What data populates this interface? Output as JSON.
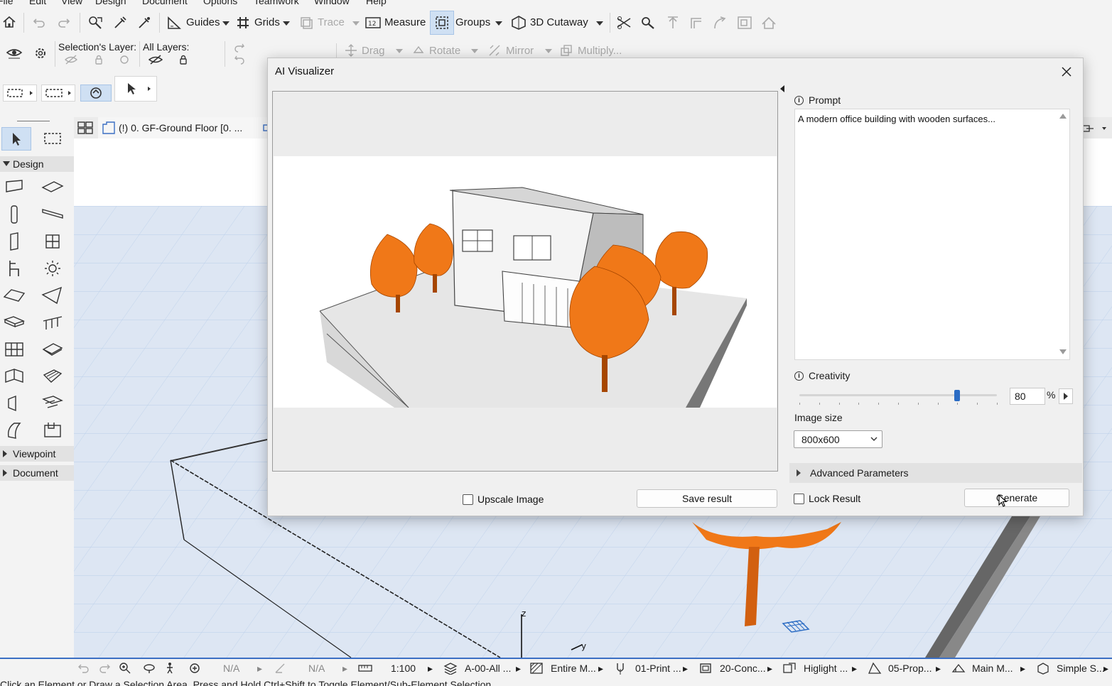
{
  "menu": [
    "File",
    "Edit",
    "View",
    "Design",
    "Document",
    "Options",
    "Teamwork",
    "Window",
    "Help"
  ],
  "toolbar1": {
    "guides": "Guides",
    "grids": "Grids",
    "trace": "Trace",
    "measure": "Measure",
    "groups": "Groups",
    "cutaway": "3D Cutaway"
  },
  "toolbar2": {
    "selection_layer": "Selection's Layer:",
    "all_layers": "All Layers:",
    "drag": "Drag",
    "rotate": "Rotate",
    "mirror": "Mirror",
    "multiply": "Multiply..."
  },
  "tab": {
    "label": "(!) 0. GF-Ground Floor [0. ..."
  },
  "palette": {
    "design": "Design",
    "viewpoint": "Viewpoint",
    "document": "Document"
  },
  "dialog": {
    "title": "AI Visualizer",
    "prompt_label": "Prompt",
    "prompt_text": "A modern office building with wooden surfaces...",
    "creativity_label": "Creativity",
    "creativity_value": "80",
    "creativity_unit": "%",
    "creativity_fraction": 0.8,
    "image_size_label": "Image size",
    "image_size_value": "800x600",
    "advanced_label": "Advanced Parameters",
    "upscale_label": "Upscale Image",
    "save_label": "Save result",
    "lock_label": "Lock Result",
    "generate_label": "Generate"
  },
  "axes": {
    "z": "z",
    "y": "y"
  },
  "statusbar": {
    "na1": "N/A",
    "na2": "N/A",
    "scale": "1:100",
    "layer": "A-00-All ...",
    "model": "Entire M...",
    "pen": "01-Print ...",
    "override": "20-Conc...",
    "highlight": "Higlight ...",
    "renovation": "05-Prop...",
    "model_view": "Main M...",
    "structure": "Simple S..."
  },
  "hint": "Click an Element or Draw a Selection Area. Press and Hold Ctrl+Shift to Toggle Element/Sub-Element Selection.",
  "colors": {
    "accent": "#3b6fc4",
    "tree": "#f07818",
    "slider": "#2b6cc4"
  }
}
